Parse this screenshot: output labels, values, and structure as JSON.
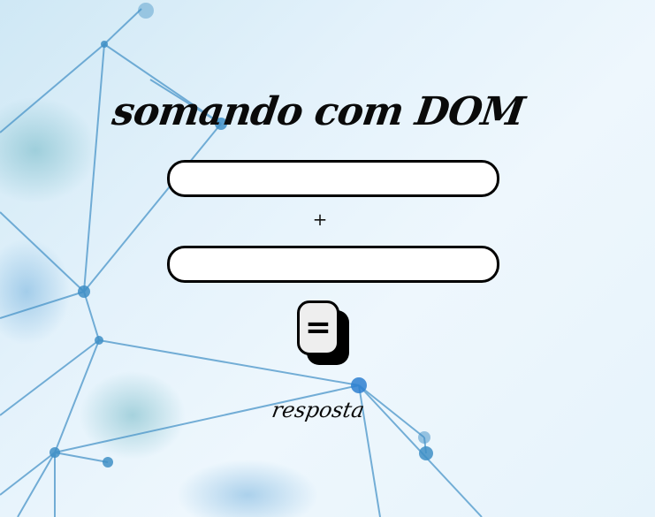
{
  "header": {
    "title": "somando com DOM"
  },
  "form": {
    "first_number": {
      "value": "",
      "placeholder": ""
    },
    "operator": "+",
    "second_number": {
      "value": "",
      "placeholder": ""
    },
    "submit_label": "="
  },
  "result": {
    "text": "resposta"
  },
  "colors": {
    "background": "#e4f2fb",
    "network_lines": "#3f8fc6",
    "text": "#0a0a0a",
    "button_face": "#eeeeee"
  }
}
